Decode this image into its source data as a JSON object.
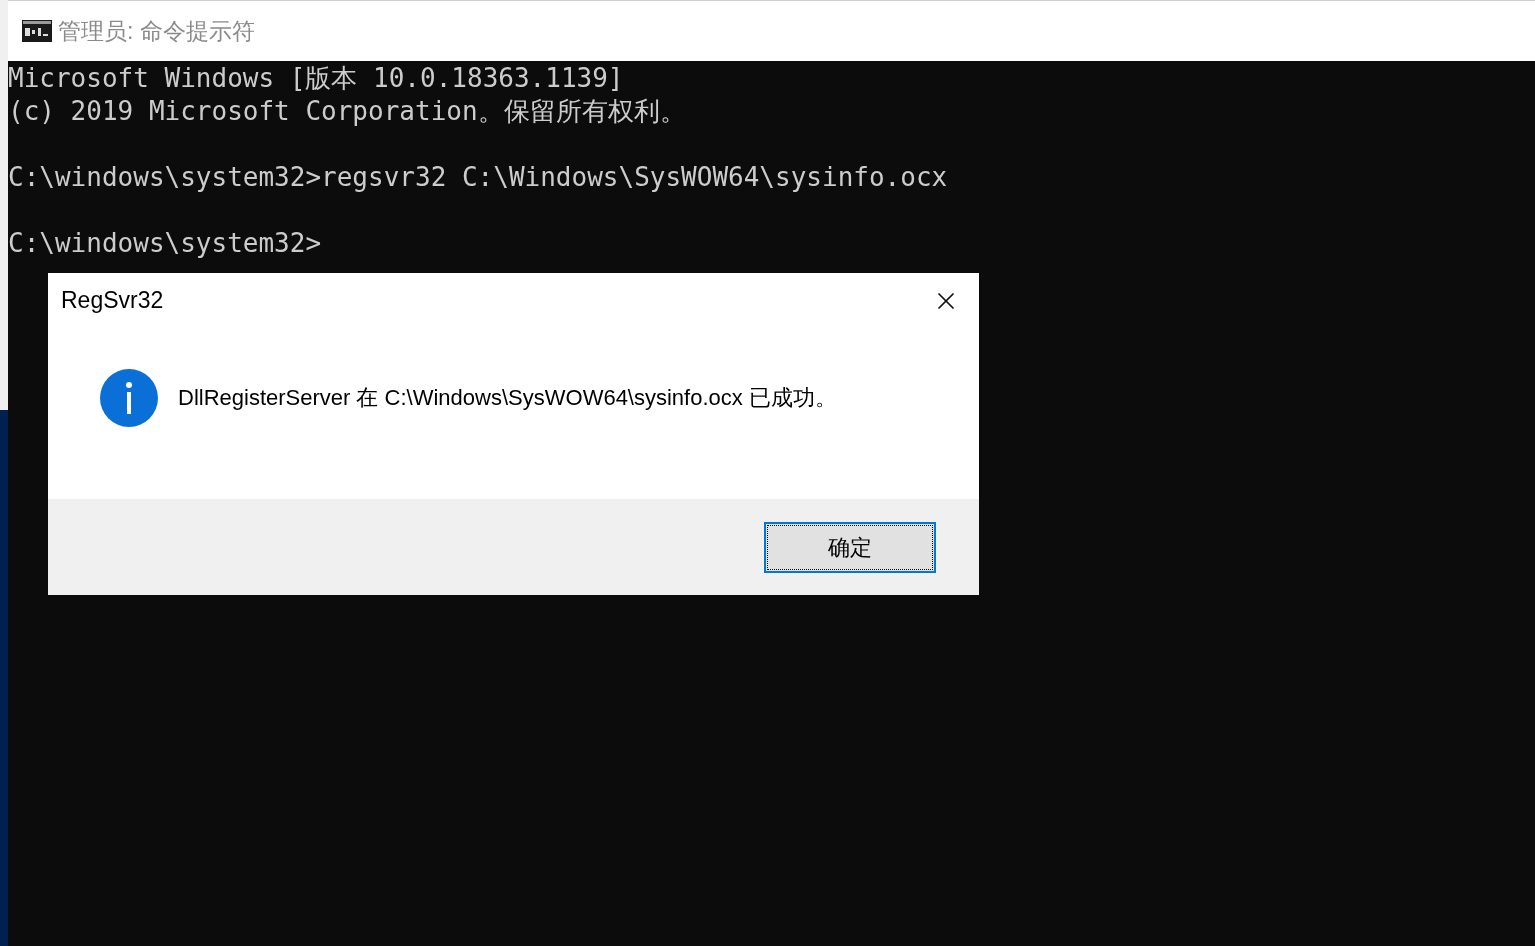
{
  "console_window": {
    "title": "管理员: 命令提示符",
    "output_blocks": [
      [
        "Microsoft Windows [版本 10.0.18363.1139]",
        "(c) 2019 Microsoft Corporation。保留所有权利。"
      ],
      [
        "C:\\windows\\system32>regsvr32 C:\\Windows\\SysWOW64\\sysinfo.ocx"
      ],
      [
        "C:\\windows\\system32>"
      ]
    ]
  },
  "dialog": {
    "title": "RegSvr32",
    "message": "DllRegisterServer 在 C:\\Windows\\SysWOW64\\sysinfo.ocx 已成功。",
    "buttons": [
      {
        "label": "确定",
        "focused": true
      }
    ]
  }
}
